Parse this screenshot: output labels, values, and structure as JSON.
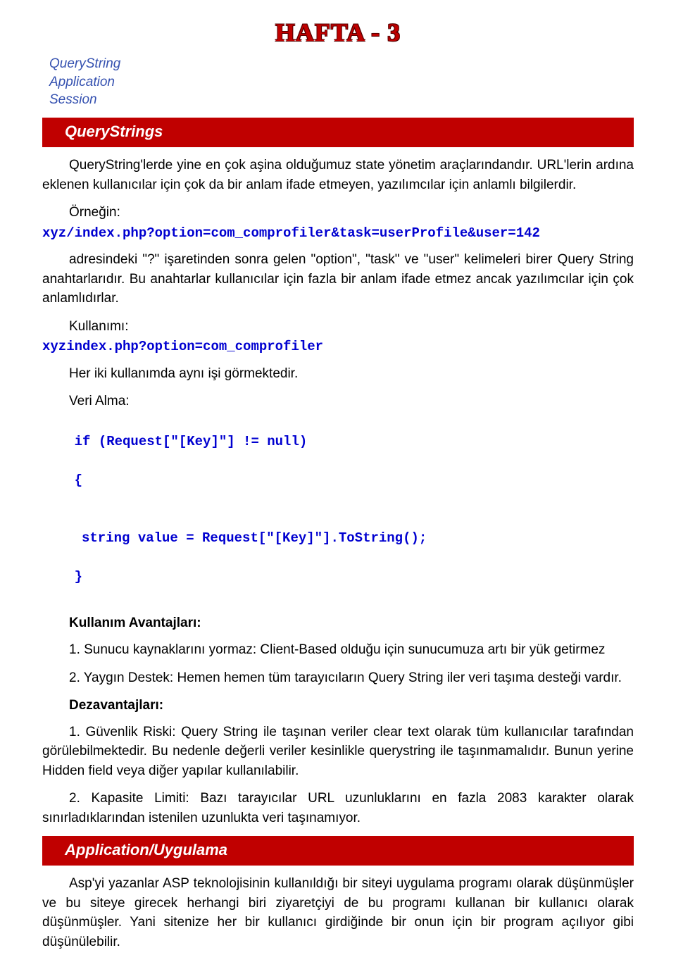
{
  "header": {
    "title": "HAFTA - 3"
  },
  "topics": [
    "QueryString",
    "Application",
    "Session"
  ],
  "sections": {
    "qs": {
      "title": "QueryStrings",
      "p1": "QueryString'lerde yine en çok aşina olduğumuz state yönetim araçlarındandır. URL'lerin ardına eklenen kullanıcılar için çok da bir anlam ifade etmeyen, yazılımcılar için anlamlı bilgilerdir.",
      "example_label": "Örneğin:",
      "example_code": "xyz/index.php?option=com_comprofiler&task=userProfile&user=142",
      "p2": "adresindeki \"?\" işaretinden sonra gelen \"option\", \"task\" ve \"user\" kelimeleri birer Query String anahtarlarıdır. Bu anahtarlar kullanıcılar için fazla bir anlam ifade etmez ancak yazılımcılar için çok anlamlıdırlar.",
      "usage_label": "Kullanımı:",
      "usage_code": "xyzindex.php?option=com_comprofiler",
      "p3": "Her iki kullanımda aynı işi görmektedir.",
      "get_label": "Veri Alma:",
      "get_code_l1": "if (Request[\"[Key]\"] != null)",
      "get_code_l2": "{",
      "get_code_l3": "string value = Request[\"[Key]\"].ToString();",
      "get_code_l4": "}",
      "adv_head": "Kullanım Avantajları:",
      "adv1": "1. Sunucu kaynaklarını yormaz: Client-Based olduğu için sunucumuza artı bir yük getirmez",
      "adv2": "2. Yaygın Destek: Hemen hemen tüm tarayıcıların Query String iler veri taşıma desteği vardır.",
      "dis_head": "Dezavantajları:",
      "dis1": "1. Güvenlik Riski: Query String ile taşınan veriler clear text olarak tüm kullanıcılar tarafından görülebilmektedir. Bu nedenle değerli veriler kesinlikle querystring ile taşınmamalıdır. Bunun yerine Hidden field veya diğer yapılar kullanılabilir.",
      "dis2": "2. Kapasite Limiti: Bazı tarayıcılar URL uzunluklarını en fazla 2083 karakter olarak sınırladıklarından istenilen uzunlukta veri taşınamıyor."
    },
    "app": {
      "title": "Application/Uygulama",
      "p1": "Asp'yi yazanlar ASP teknolojisinin kullanıldığı bir siteyi uygulama programı olarak düşünmüşler ve bu siteye girecek herhangi biri ziyaretçiyi de bu programı kullanan bir kullanıcı olarak düşünmüşler. Yani sitenize her bir kullanıcı girdiğinde bir onun için bir program açılıyor gibi düşünülebilir."
    }
  }
}
